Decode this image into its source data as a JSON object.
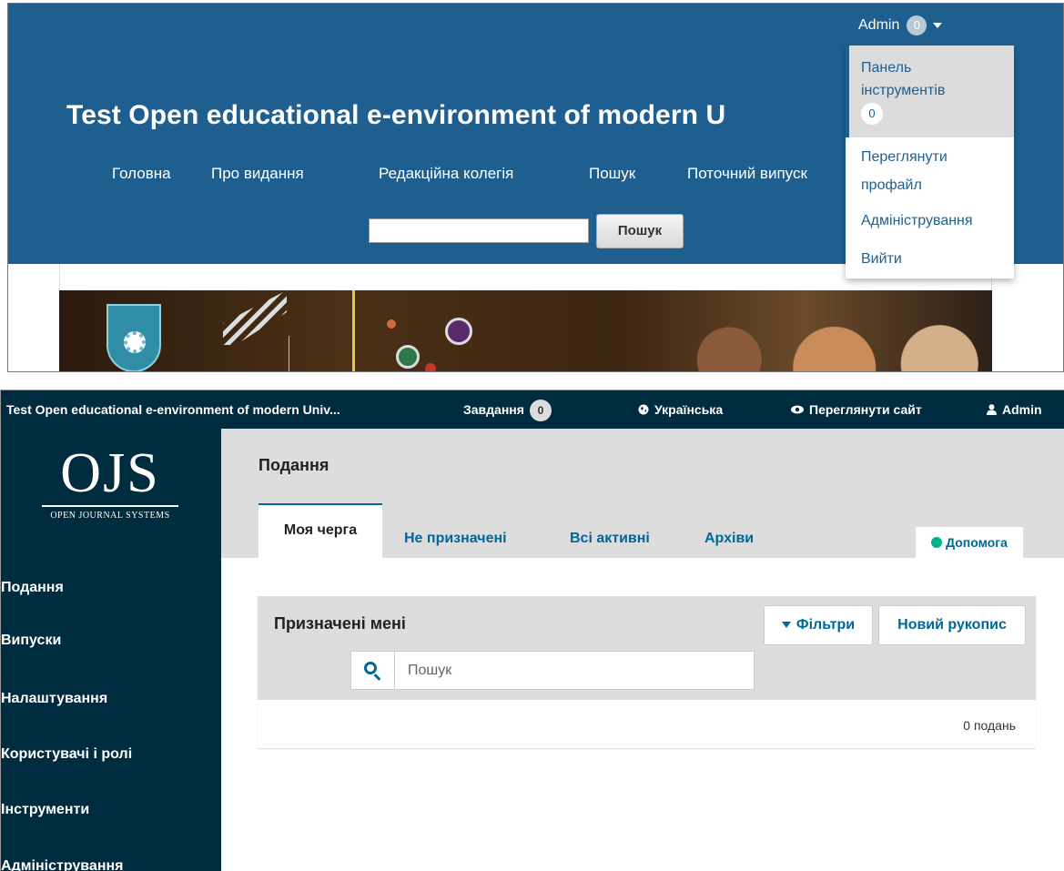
{
  "site": {
    "title": "Test Open educational e-environment of modern U",
    "nav": [
      "Головна",
      "Про видання",
      "Редакційна колегія",
      "Пошук",
      "Поточний випуск"
    ],
    "search_button": "Пошук",
    "user": {
      "name": "Admin",
      "badge": "0"
    },
    "dropdown": {
      "dashboard_line1": "Панель",
      "dashboard_line2": "інструментів",
      "dashboard_badge": "0",
      "view_profile_line1": "Переглянути",
      "view_profile_line2": "профайл",
      "administration": "Адміністрування",
      "logout": "Вийти"
    }
  },
  "ojs": {
    "topbar": {
      "journal": "Test Open educational e-environment of modern Univ...",
      "tasks_label": "Завдання",
      "tasks_badge": "0",
      "language": "Українська",
      "view_site": "Переглянути сайт",
      "user": "Admin"
    },
    "logo": {
      "mark": "OJS",
      "subtitle": "OPEN JOURNAL SYSTEMS"
    },
    "sidebar": [
      "Подання",
      "Випуски",
      "Налаштування",
      "Користувачі і ролі",
      "Інструменти",
      "Адміністрування"
    ],
    "page_title": "Подання",
    "tabs": [
      "Моя черга",
      "Не призначені",
      "Всі активні",
      "Архіви"
    ],
    "help": "Допомога",
    "list": {
      "title": "Призначені мені",
      "filters": "Фільтри",
      "new_submission": "Новий рукопис",
      "search_placeholder": "Пошук",
      "count": "0 подань"
    }
  },
  "colors": {
    "site_header": "#1f5f8f",
    "ojs_dark": "#002c3f",
    "ojs_link": "#006798",
    "ojs_grey": "#dddddd"
  },
  "icons": {
    "user_caret": "chevron-down-icon",
    "language": "globe-icon",
    "view_site": "eye-icon",
    "user": "user-icon",
    "help": "info-icon",
    "filters": "funnel-icon",
    "search": "search-icon"
  }
}
